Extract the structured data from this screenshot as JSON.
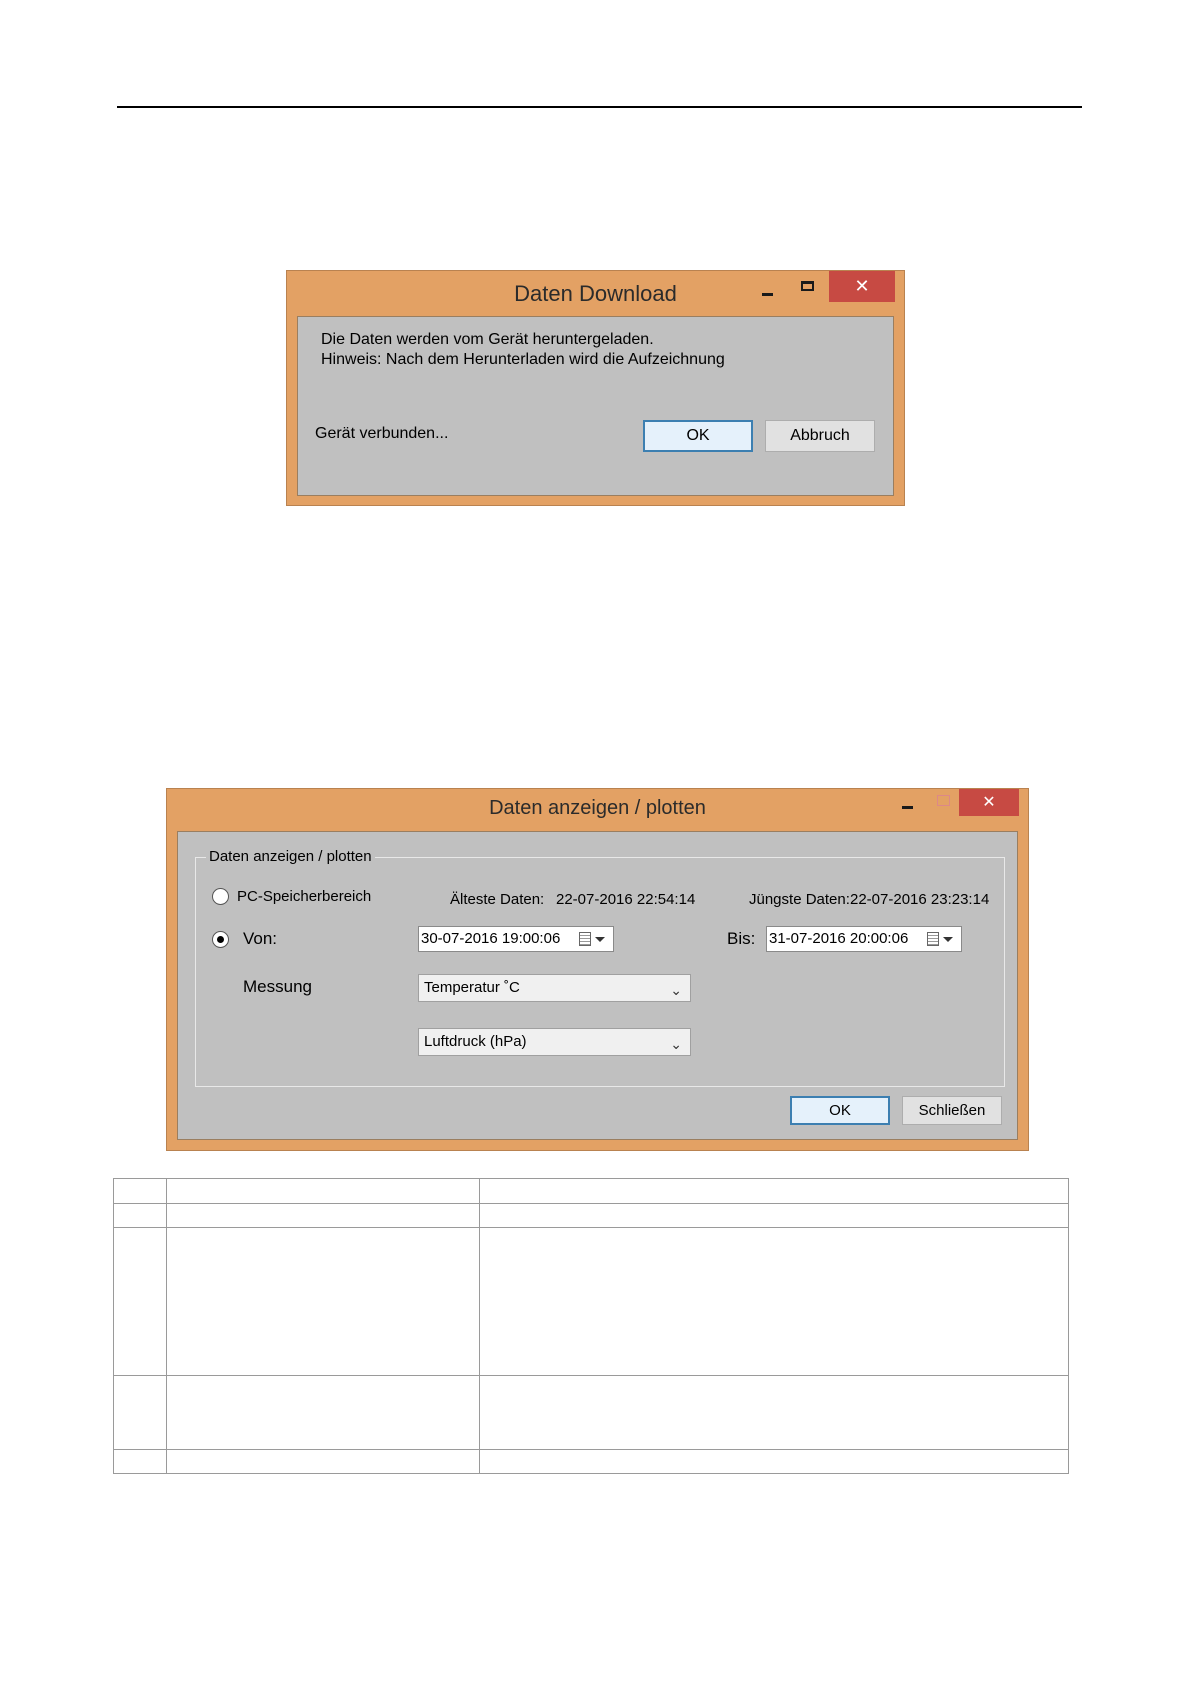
{
  "dialog_download": {
    "title": "Daten Download",
    "message_line1": "Die Daten werden vom Gerät heruntergeladen.",
    "message_line2": "Hinweis: Nach dem Herunterladen wird die Aufzeichnung",
    "status": "Gerät verbunden...",
    "ok_label": "OK",
    "cancel_label": "Abbruch",
    "close_glyph": "✕"
  },
  "dialog_plot": {
    "title": "Daten anzeigen / plotten",
    "group_label": "Daten anzeigen / plotten",
    "pc_storage_label": "PC-Speicherbereich",
    "oldest_label": "Älteste Daten:",
    "oldest_value": "22-07-2016 22:54:14",
    "newest_label": "Jüngste Daten:",
    "newest_value": "22-07-2016 23:23:14",
    "from_label": "Von:",
    "from_value": "30-07-2016 19:00:06",
    "to_label": "Bis:",
    "to_value": "31-07-2016 20:00:06",
    "measurement_label": "Messung",
    "measurement_1": "Temperatur ˚C",
    "measurement_2": "Luftdruck (hPa)",
    "ok_label": "OK",
    "close_label": "Schließen",
    "close_glyph": "✕",
    "selected_radio": "Von"
  }
}
